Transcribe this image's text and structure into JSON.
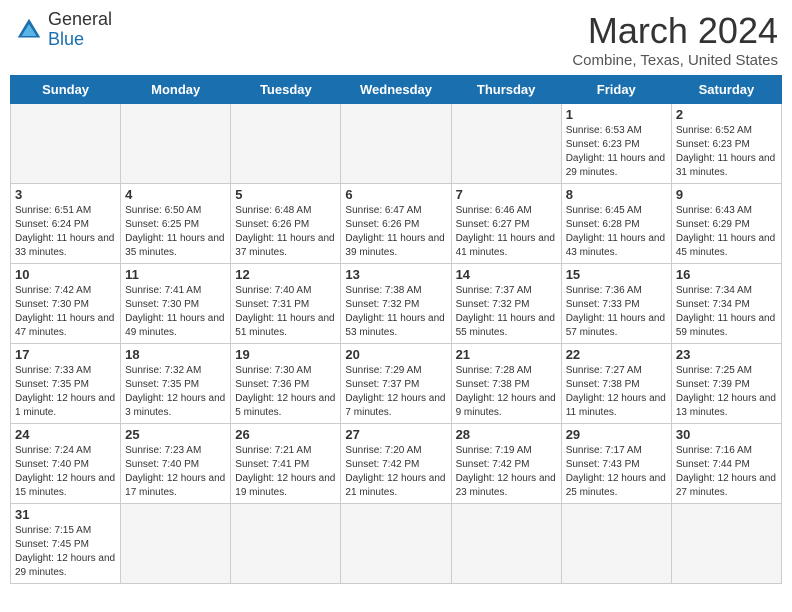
{
  "header": {
    "logo_general": "General",
    "logo_blue": "Blue",
    "month_title": "March 2024",
    "location": "Combine, Texas, United States"
  },
  "weekdays": [
    "Sunday",
    "Monday",
    "Tuesday",
    "Wednesday",
    "Thursday",
    "Friday",
    "Saturday"
  ],
  "weeks": [
    [
      {
        "day": "",
        "info": ""
      },
      {
        "day": "",
        "info": ""
      },
      {
        "day": "",
        "info": ""
      },
      {
        "day": "",
        "info": ""
      },
      {
        "day": "",
        "info": ""
      },
      {
        "day": "1",
        "info": "Sunrise: 6:53 AM\nSunset: 6:23 PM\nDaylight: 11 hours\nand 29 minutes."
      },
      {
        "day": "2",
        "info": "Sunrise: 6:52 AM\nSunset: 6:23 PM\nDaylight: 11 hours\nand 31 minutes."
      }
    ],
    [
      {
        "day": "3",
        "info": "Sunrise: 6:51 AM\nSunset: 6:24 PM\nDaylight: 11 hours\nand 33 minutes."
      },
      {
        "day": "4",
        "info": "Sunrise: 6:50 AM\nSunset: 6:25 PM\nDaylight: 11 hours\nand 35 minutes."
      },
      {
        "day": "5",
        "info": "Sunrise: 6:48 AM\nSunset: 6:26 PM\nDaylight: 11 hours\nand 37 minutes."
      },
      {
        "day": "6",
        "info": "Sunrise: 6:47 AM\nSunset: 6:26 PM\nDaylight: 11 hours\nand 39 minutes."
      },
      {
        "day": "7",
        "info": "Sunrise: 6:46 AM\nSunset: 6:27 PM\nDaylight: 11 hours\nand 41 minutes."
      },
      {
        "day": "8",
        "info": "Sunrise: 6:45 AM\nSunset: 6:28 PM\nDaylight: 11 hours\nand 43 minutes."
      },
      {
        "day": "9",
        "info": "Sunrise: 6:43 AM\nSunset: 6:29 PM\nDaylight: 11 hours\nand 45 minutes."
      }
    ],
    [
      {
        "day": "10",
        "info": "Sunrise: 7:42 AM\nSunset: 7:30 PM\nDaylight: 11 hours\nand 47 minutes."
      },
      {
        "day": "11",
        "info": "Sunrise: 7:41 AM\nSunset: 7:30 PM\nDaylight: 11 hours\nand 49 minutes."
      },
      {
        "day": "12",
        "info": "Sunrise: 7:40 AM\nSunset: 7:31 PM\nDaylight: 11 hours\nand 51 minutes."
      },
      {
        "day": "13",
        "info": "Sunrise: 7:38 AM\nSunset: 7:32 PM\nDaylight: 11 hours\nand 53 minutes."
      },
      {
        "day": "14",
        "info": "Sunrise: 7:37 AM\nSunset: 7:32 PM\nDaylight: 11 hours\nand 55 minutes."
      },
      {
        "day": "15",
        "info": "Sunrise: 7:36 AM\nSunset: 7:33 PM\nDaylight: 11 hours\nand 57 minutes."
      },
      {
        "day": "16",
        "info": "Sunrise: 7:34 AM\nSunset: 7:34 PM\nDaylight: 11 hours\nand 59 minutes."
      }
    ],
    [
      {
        "day": "17",
        "info": "Sunrise: 7:33 AM\nSunset: 7:35 PM\nDaylight: 12 hours\nand 1 minute."
      },
      {
        "day": "18",
        "info": "Sunrise: 7:32 AM\nSunset: 7:35 PM\nDaylight: 12 hours\nand 3 minutes."
      },
      {
        "day": "19",
        "info": "Sunrise: 7:30 AM\nSunset: 7:36 PM\nDaylight: 12 hours\nand 5 minutes."
      },
      {
        "day": "20",
        "info": "Sunrise: 7:29 AM\nSunset: 7:37 PM\nDaylight: 12 hours\nand 7 minutes."
      },
      {
        "day": "21",
        "info": "Sunrise: 7:28 AM\nSunset: 7:38 PM\nDaylight: 12 hours\nand 9 minutes."
      },
      {
        "day": "22",
        "info": "Sunrise: 7:27 AM\nSunset: 7:38 PM\nDaylight: 12 hours\nand 11 minutes."
      },
      {
        "day": "23",
        "info": "Sunrise: 7:25 AM\nSunset: 7:39 PM\nDaylight: 12 hours\nand 13 minutes."
      }
    ],
    [
      {
        "day": "24",
        "info": "Sunrise: 7:24 AM\nSunset: 7:40 PM\nDaylight: 12 hours\nand 15 minutes."
      },
      {
        "day": "25",
        "info": "Sunrise: 7:23 AM\nSunset: 7:40 PM\nDaylight: 12 hours\nand 17 minutes."
      },
      {
        "day": "26",
        "info": "Sunrise: 7:21 AM\nSunset: 7:41 PM\nDaylight: 12 hours\nand 19 minutes."
      },
      {
        "day": "27",
        "info": "Sunrise: 7:20 AM\nSunset: 7:42 PM\nDaylight: 12 hours\nand 21 minutes."
      },
      {
        "day": "28",
        "info": "Sunrise: 7:19 AM\nSunset: 7:42 PM\nDaylight: 12 hours\nand 23 minutes."
      },
      {
        "day": "29",
        "info": "Sunrise: 7:17 AM\nSunset: 7:43 PM\nDaylight: 12 hours\nand 25 minutes."
      },
      {
        "day": "30",
        "info": "Sunrise: 7:16 AM\nSunset: 7:44 PM\nDaylight: 12 hours\nand 27 minutes."
      }
    ],
    [
      {
        "day": "31",
        "info": "Sunrise: 7:15 AM\nSunset: 7:45 PM\nDaylight: 12 hours\nand 29 minutes."
      },
      {
        "day": "",
        "info": ""
      },
      {
        "day": "",
        "info": ""
      },
      {
        "day": "",
        "info": ""
      },
      {
        "day": "",
        "info": ""
      },
      {
        "day": "",
        "info": ""
      },
      {
        "day": "",
        "info": ""
      }
    ]
  ]
}
